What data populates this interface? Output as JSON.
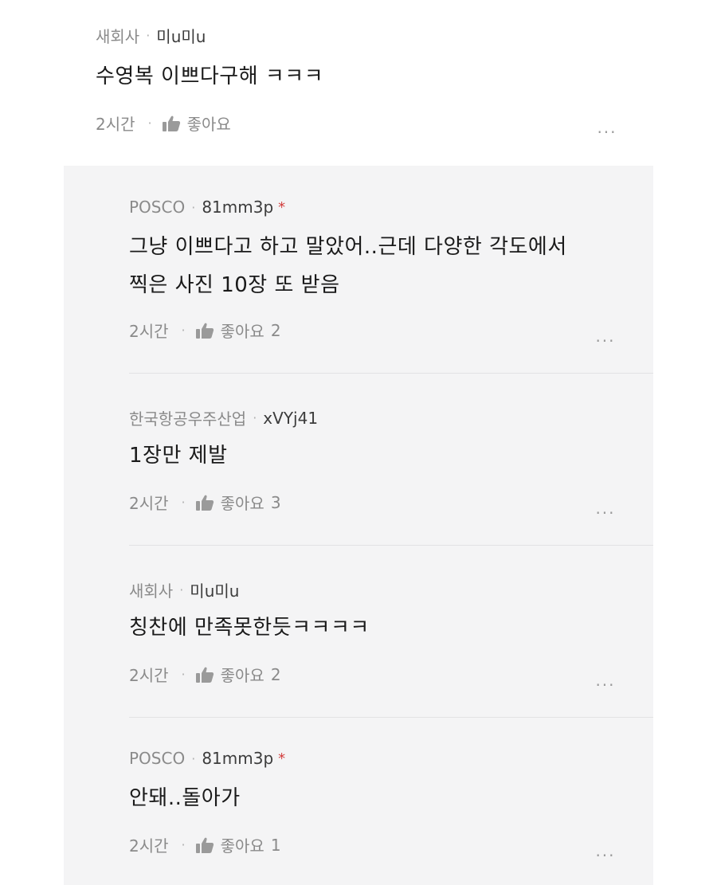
{
  "top_comment": {
    "company": "새회사",
    "nickname": "미u미u",
    "text": "수영복 이쁘다구해 ㅋㅋㅋ",
    "time": "2시간",
    "like_label": "좋아요",
    "like_count": "",
    "more_label": "..."
  },
  "replies": [
    {
      "company": "POSCO",
      "nickname": "81mm3p",
      "author_mark": "*",
      "text_line1": "그냥 이쁘다고 하고 말았어..근데 다양한 각도에서",
      "text_line2": "찍은 사진 10장 또 받음",
      "time": "2시간",
      "like_label": "좋아요",
      "like_count": "2",
      "more_label": "..."
    },
    {
      "company": "한국항공우주산업",
      "nickname": "xVYj41",
      "author_mark": "",
      "text_line1": "1장만 제발",
      "text_line2": "",
      "time": "2시간",
      "like_label": "좋아요",
      "like_count": "3",
      "more_label": "..."
    },
    {
      "company": "새회사",
      "nickname": "미u미u",
      "author_mark": "",
      "text_line1": "칭찬에 만족못한듯ㅋㅋㅋㅋ",
      "text_line2": "",
      "time": "2시간",
      "like_label": "좋아요",
      "like_count": "2",
      "more_label": "..."
    },
    {
      "company": "POSCO",
      "nickname": "81mm3p",
      "author_mark": "*",
      "text_line1": "안돼..돌아가",
      "text_line2": "",
      "time": "2시간",
      "like_label": "좋아요",
      "like_count": "1",
      "more_label": "..."
    }
  ],
  "icons": {
    "separator_dot": "·",
    "like": "thumbs-up-icon",
    "more": "more-dots-icon"
  },
  "colors": {
    "reply_background": "#f4f4f5",
    "meta_gray": "#8a8a8a",
    "author_star": "#d23c3c"
  }
}
